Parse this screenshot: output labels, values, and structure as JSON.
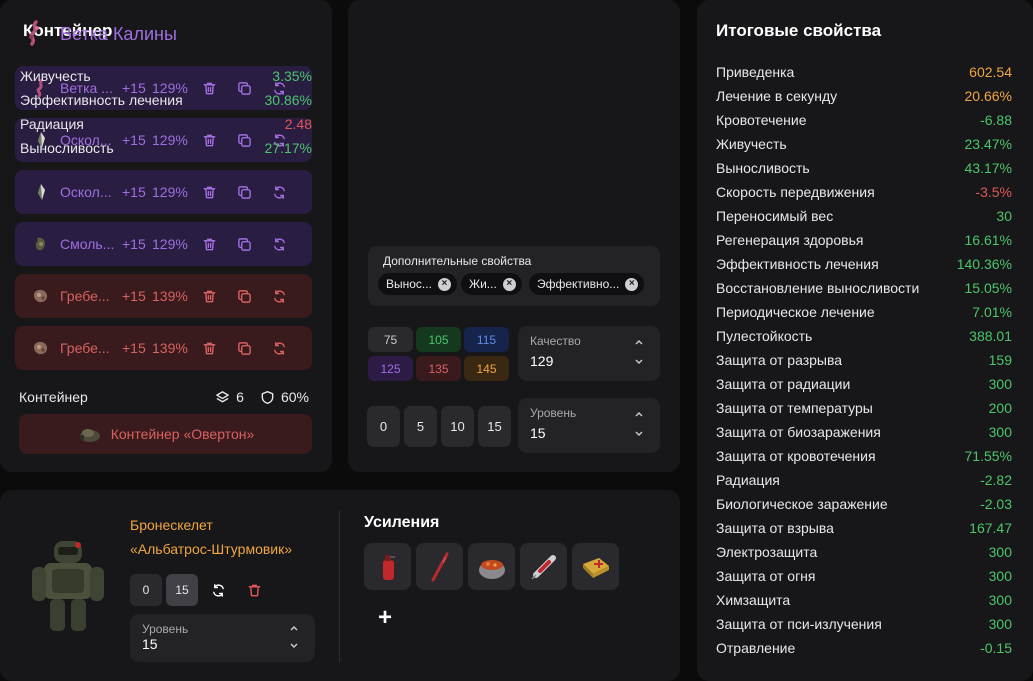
{
  "container_panel": {
    "title": "Контейнер",
    "rows": [
      {
        "name": "Ветка ...",
        "level": "+15",
        "percent": "129%",
        "tone": "purple",
        "icon": "branch-artifact-icon"
      },
      {
        "name": "Оскол...",
        "level": "+15",
        "percent": "129%",
        "tone": "purple",
        "icon": "shard-artifact-icon"
      },
      {
        "name": "Оскол...",
        "level": "+15",
        "percent": "129%",
        "tone": "purple",
        "icon": "shard-artifact-icon"
      },
      {
        "name": "Смоль...",
        "level": "+15",
        "percent": "129%",
        "tone": "purple",
        "icon": "resin-artifact-icon"
      },
      {
        "name": "Гребе...",
        "level": "+15",
        "percent": "139%",
        "tone": "red",
        "icon": "comb-artifact-icon"
      },
      {
        "name": "Гребе...",
        "level": "+15",
        "percent": "139%",
        "tone": "red",
        "icon": "comb-artifact-icon"
      }
    ],
    "footer_label": "Контейнер",
    "slots": "6",
    "protection": "60%",
    "container_button": "Контейнер «Овертон»"
  },
  "item_panel": {
    "title": "Ветка Калины",
    "stats": [
      {
        "name": "Живучесть",
        "value": "3.35%",
        "tone": "green"
      },
      {
        "name": "Эффективность лечения",
        "value": "30.86%",
        "tone": "green"
      },
      {
        "name": "Радиация",
        "value": "2.48",
        "tone": "red"
      },
      {
        "name": "Выносливость",
        "value": "27.17%",
        "tone": "green"
      }
    ],
    "extra_label": "Дополнительные свойства",
    "chips": [
      "Вынос...",
      "Жи...",
      "Эффективно..."
    ],
    "quality_presets": [
      {
        "value": "75",
        "bg": "#2a2a2e",
        "fg": "#c9c9cd"
      },
      {
        "value": "105",
        "bg": "#15391f",
        "fg": "#4cc56a"
      },
      {
        "value": "115",
        "bg": "#16234a",
        "fg": "#5f8be6"
      },
      {
        "value": "125",
        "bg": "#2c1c45",
        "fg": "#a06ee0"
      },
      {
        "value": "135",
        "bg": "#3a1b1d",
        "fg": "#d86161"
      },
      {
        "value": "145",
        "bg": "#3a2813",
        "fg": "#f0a540"
      }
    ],
    "quality": {
      "label": "Качество",
      "value": "129"
    },
    "level_presets": [
      "0",
      "5",
      "10",
      "15"
    ],
    "level": {
      "label": "Уровень",
      "value": "15"
    }
  },
  "armor_panel": {
    "name_line1": "Бронескелет",
    "name_line2": "«Альбатрос-Штурмовик»",
    "level_presets": [
      "0",
      "15"
    ],
    "level": {
      "label": "Уровень",
      "value": "15"
    },
    "boosts_title": "Усиления",
    "boost_icons": [
      "spray-bottle-icon",
      "stick-icon",
      "stew-pot-icon",
      "syringe-icon",
      "first-aid-kit-icon"
    ],
    "add_label": "+"
  },
  "totals_panel": {
    "title": "Итоговые свойства",
    "stats": [
      {
        "name": "Приведенка",
        "value": "602.54",
        "tone": "orange"
      },
      {
        "name": "Лечение в секунду",
        "value": "20.66%",
        "tone": "orange"
      },
      {
        "name": "Кровотечение",
        "value": "-6.88",
        "tone": "green"
      },
      {
        "name": "Живучесть",
        "value": "23.47%",
        "tone": "green"
      },
      {
        "name": "Выносливость",
        "value": "43.17%",
        "tone": "green"
      },
      {
        "name": "Скорость передвижения",
        "value": "-3.5%",
        "tone": "red"
      },
      {
        "name": "Переносимый вес",
        "value": "30",
        "tone": "green"
      },
      {
        "name": "Регенерация здоровья",
        "value": "16.61%",
        "tone": "green"
      },
      {
        "name": "Эффективность лечения",
        "value": "140.36%",
        "tone": "green"
      },
      {
        "name": "Восстановление выносливости",
        "value": "15.05%",
        "tone": "green"
      },
      {
        "name": "Периодическое лечение",
        "value": "7.01%",
        "tone": "green"
      },
      {
        "name": "Пулестойкость",
        "value": "388.01",
        "tone": "green"
      },
      {
        "name": "Защита от разрыва",
        "value": "159",
        "tone": "green"
      },
      {
        "name": "Защита от радиации",
        "value": "300",
        "tone": "green"
      },
      {
        "name": "Защита от температуры",
        "value": "200",
        "tone": "green"
      },
      {
        "name": "Защита от биозаражения",
        "value": "300",
        "tone": "green"
      },
      {
        "name": "Защита от кровотечения",
        "value": "71.55%",
        "tone": "green"
      },
      {
        "name": "Радиация",
        "value": "-2.82",
        "tone": "green"
      },
      {
        "name": "Биологическое заражение",
        "value": "-2.03",
        "tone": "green"
      },
      {
        "name": "Защита от взрыва",
        "value": "167.47",
        "tone": "green"
      },
      {
        "name": "Электрозащита",
        "value": "300",
        "tone": "green"
      },
      {
        "name": "Защита от огня",
        "value": "300",
        "tone": "green"
      },
      {
        "name": "Химзащита",
        "value": "300",
        "tone": "green"
      },
      {
        "name": "Защита от пси-излучения",
        "value": "300",
        "tone": "green"
      },
      {
        "name": "Отравление",
        "value": "-0.15",
        "tone": "green"
      }
    ]
  }
}
